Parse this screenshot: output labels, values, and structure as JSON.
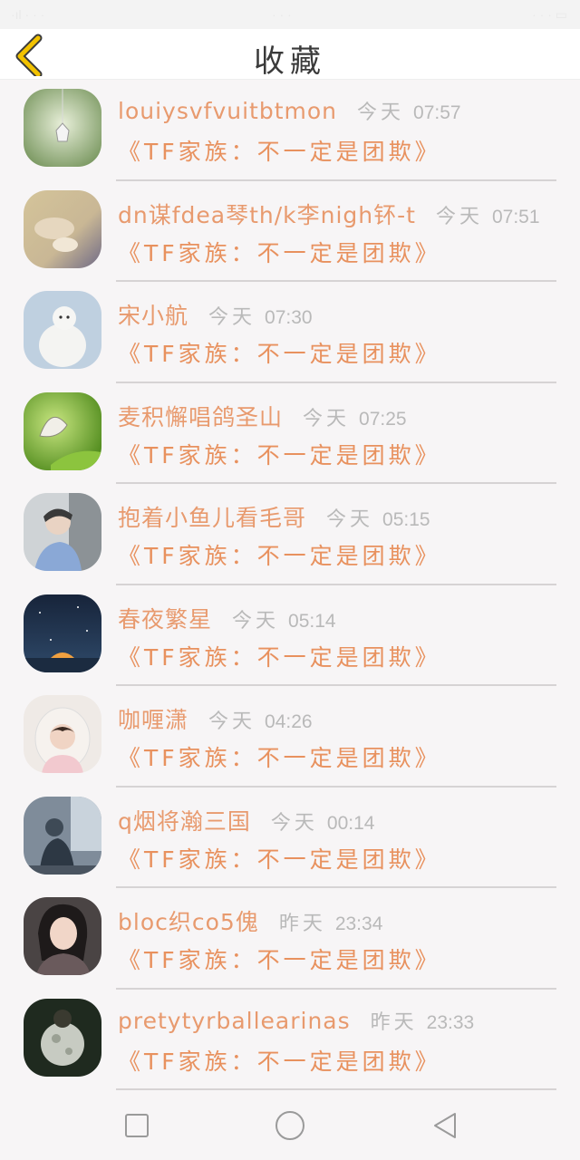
{
  "status_bar": {
    "left": "·ıl · · ·",
    "center": "· · ·",
    "right": "· · · ▭"
  },
  "header": {
    "title": "收藏",
    "back_icon": "chevron-left-icon",
    "accent": "#f2c200"
  },
  "colors": {
    "name": "#e89a6e",
    "title": "#e8915e",
    "time": "#b9b9b9",
    "divider": "#d6d3d4"
  },
  "items": [
    {
      "name": "louiysvfvuitbtmon",
      "day": "今天",
      "time": "07:57",
      "title": "《TF家族：不一定是团欺》"
    },
    {
      "name": "dn谋fdea琴th/k李nigh钚-t",
      "day": "今天",
      "time": "07:51",
      "title": "《TF家族：不一定是团欺》"
    },
    {
      "name": "宋小航",
      "day": "今天",
      "time": "07:30",
      "title": "《TF家族：不一定是团欺》"
    },
    {
      "name": "麦积懈唱鸽圣山",
      "day": "今天",
      "time": "07:25",
      "title": "《TF家族：不一定是团欺》"
    },
    {
      "name": "抱着小鱼儿看毛哥",
      "day": "今天",
      "time": "05:15",
      "title": "《TF家族：不一定是团欺》"
    },
    {
      "name": "春夜繁星",
      "day": "今天",
      "time": "05:14",
      "title": "《TF家族：不一定是团欺》"
    },
    {
      "name": "咖喱潇",
      "day": "今天",
      "time": "04:26",
      "title": "《TF家族：不一定是团欺》"
    },
    {
      "name": "q烟将瀚三国",
      "day": "今天",
      "time": "00:14",
      "title": "《TF家族：不一定是团欺》"
    },
    {
      "name": "bloc织co5傀",
      "day": "昨天",
      "time": "23:34",
      "title": "《TF家族：不一定是团欺》"
    },
    {
      "name": "pretytyrballearinas",
      "day": "昨天",
      "time": "23:33",
      "title": "《TF家族：不一定是团欺》"
    }
  ],
  "nav_bar": {
    "recent_icon": "square-icon",
    "home_icon": "circle-icon",
    "back_icon": "triangle-back-icon"
  }
}
